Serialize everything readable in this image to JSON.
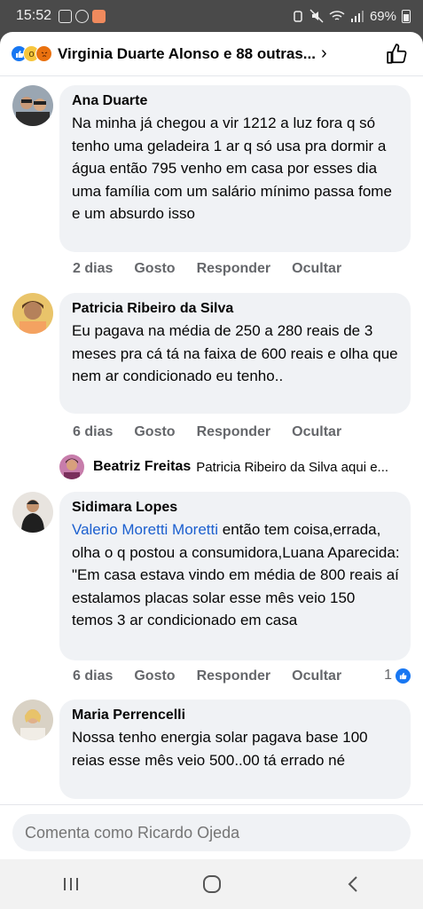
{
  "status_bar": {
    "time": "15:52",
    "battery": "69%"
  },
  "reactions": {
    "summary": "Virginia Duarte Alonso e 88 outras...",
    "emoji_icons": [
      "like-icon",
      "wow-icon",
      "angry-icon"
    ]
  },
  "comments": [
    {
      "author": "Ana Duarte",
      "text": "Na minha já chegou a vir 1212 a luz fora q só tenho uma geladeira 1 ar q só usa pra dormir a água então 795 venho em casa por esses dia uma família com um salário mínimo passa fome e um absurdo isso",
      "time": "2 dias",
      "like_label": "Gosto",
      "reply_label": "Responder",
      "hide_label": "Ocultar"
    },
    {
      "author": "Patricia Ribeiro da Silva",
      "text": "Eu pagava na média de 250 a 280 reais de 3 meses pra cá tá na faixa de 600 reais e olha que nem ar condicionado eu tenho..",
      "time": "6 dias",
      "like_label": "Gosto",
      "reply_label": "Responder",
      "hide_label": "Ocultar"
    },
    {
      "author": "Sidimara Lopes",
      "mention": "Valerio Moretti Moretti",
      "text": " então tem coisa,errada, olha o q postou a consumidora,Luana Aparecida: \"Em casa estava vindo em média de 800 reais aí estalamos placas solar esse mês veio 150 temos 3 ar condicionado em casa",
      "time": "6 dias",
      "like_label": "Gosto",
      "reply_label": "Responder",
      "hide_label": "Ocultar",
      "like_count": "1"
    },
    {
      "author": "Maria Perrencelli",
      "text": "Nossa tenho energia solar pagava base 100 reias  esse mês veio 500..00 tá errado né"
    }
  ],
  "reply_preview": {
    "author": "Beatriz Freitas",
    "text": "Patricia Ribeiro da Silva aqui e..."
  },
  "composer": {
    "placeholder": "Comenta como Ricardo Ojeda"
  },
  "colors": {
    "link": "#1b5fcf",
    "bubble": "#f0f2f5",
    "meta": "#65676b",
    "brand": "#1877f2"
  }
}
